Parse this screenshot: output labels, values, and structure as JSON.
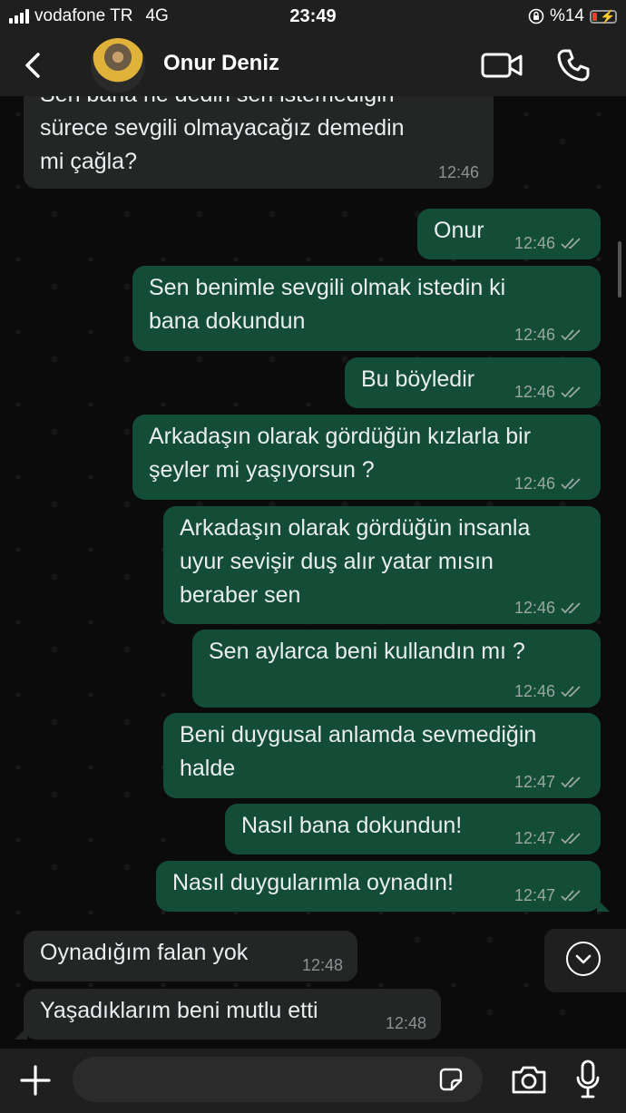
{
  "status": {
    "carrier": "vodafone TR",
    "network": "4G",
    "time": "23:49",
    "battery_label": "%14"
  },
  "header": {
    "contact_name": "Onur Deniz"
  },
  "messages": [
    {
      "dir": "in",
      "lines": [
        "Sen bana ne dedin sen istemediğin",
        "sürece sevgili olmayacağız demedin",
        "mi çağla?"
      ],
      "time": "12:46"
    },
    {
      "dir": "out",
      "lines": [
        "Onur"
      ],
      "time": "12:46"
    },
    {
      "dir": "out",
      "lines": [
        "Sen benimle sevgili olmak istedin ki",
        "bana dokundun"
      ],
      "time": "12:46"
    },
    {
      "dir": "out",
      "lines": [
        "Bu böyledir"
      ],
      "time": "12:46"
    },
    {
      "dir": "out",
      "lines": [
        "Arkadaşın olarak gördüğün kızlarla bir",
        "şeyler mi yaşıyorsun ?"
      ],
      "time": "12:46"
    },
    {
      "dir": "out",
      "lines": [
        "Arkadaşın olarak gördüğün insanla",
        "uyur sevişir duş alır yatar mısın",
        "beraber sen"
      ],
      "time": "12:46"
    },
    {
      "dir": "out",
      "lines": [
        "Sen aylarca beni kullandın mı ?"
      ],
      "time": "12:46"
    },
    {
      "dir": "out",
      "lines": [
        "Beni duygusal anlamda sevmediğin",
        "halde"
      ],
      "time": "12:47"
    },
    {
      "dir": "out",
      "lines": [
        "Nasıl bana dokundun!"
      ],
      "time": "12:47"
    },
    {
      "dir": "out",
      "lines": [
        "Nasıl duygularımla oynadın!"
      ],
      "time": "12:47"
    },
    {
      "dir": "in",
      "lines": [
        "Oynadığım falan yok"
      ],
      "time": "12:48"
    },
    {
      "dir": "in",
      "lines": [
        "Yaşadıklarım beni mutlu etti"
      ],
      "time": "12:48"
    }
  ],
  "icons": {
    "back": "chevron-left-icon",
    "video": "video-call-icon",
    "phone": "phone-icon",
    "plus": "plus-icon",
    "sticker": "sticker-icon",
    "camera": "camera-icon",
    "mic": "microphone-icon",
    "scroll": "chevron-down-icon",
    "read": "double-check-icon"
  },
  "colors": {
    "outgoing": "#144d37",
    "incoming": "#242626",
    "bar": "#1f1f1f"
  }
}
